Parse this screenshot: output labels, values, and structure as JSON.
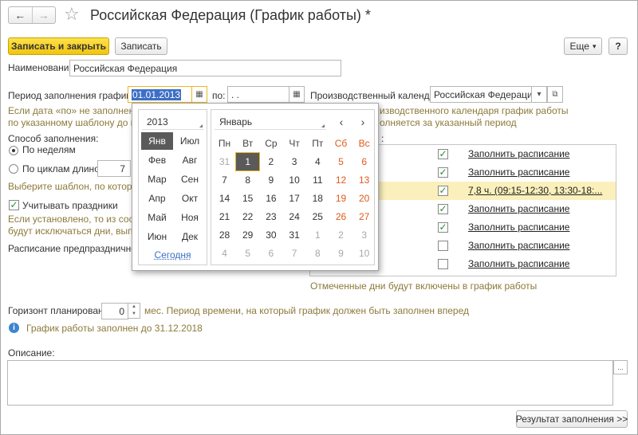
{
  "window": {
    "title": "Российская Федерация (График работы) *",
    "back_glyph": "←",
    "forward_glyph": "→",
    "favorite_glyph": "☆"
  },
  "toolbar": {
    "save_close": "Записать и закрыть",
    "save": "Записать",
    "more": "Еще",
    "more_arrow": "▾",
    "help": "?"
  },
  "form": {
    "name_label": "Наименование:",
    "name_value": "Российская Федерация",
    "period_label": "Период заполнения графика с:",
    "period_from": "01.01.2013",
    "period_to_label": "по:",
    "period_to_value": " .  .",
    "calendar_label": "Производственный календарь:",
    "calendar_value": "Российская Федерация",
    "hint_lines": [
      "Если дата «по» не заполнена, г",
      "по указанному шаблону до конц"
    ],
    "hint_right_lines": [
      "изводственного календаря график работы",
      "олняется за указанный период"
    ],
    "fill_method_label": "Способ заполнения:",
    "by_weeks": "По неделям",
    "by_cycles": "По циклам длиной",
    "cycle_length": "7",
    "template_hint": "Выберите шаблон, по которому",
    "holidays_label": "Учитывать праздники",
    "holidays_checked": true,
    "holidays_hint_lines": [
      "Если установлено, то из состава",
      "будут исключаться дни, выпада"
    ],
    "preholiday_label": "Расписание предпраздничного д",
    "right_colon": ":",
    "horizon_label": "Горизонт планирования:",
    "horizon_value": "0",
    "horizon_hint": "мес. Период времени, на который график должен быть заполнен вперед",
    "info_text": "График работы заполнен до 31.12.2018",
    "description_label": "Описание:",
    "description_value": "",
    "result_button": "Результат заполнения >>",
    "ellipsis": "...",
    "calendar_glyph": "▦",
    "dropdown_glyph": "▾",
    "open_glyph": "⧉",
    "info_glyph": "i",
    "check_glyph": "✓",
    "spin_up": "▲",
    "spin_down": "▼"
  },
  "schedule": {
    "rows": [
      {
        "checked": true,
        "text": "Заполнить расписание",
        "highlight": false
      },
      {
        "checked": true,
        "text": "Заполнить расписание",
        "highlight": false
      },
      {
        "checked": true,
        "text": "7,8 ч. (09:15-12:30, 13:30-18:...",
        "highlight": true
      },
      {
        "checked": true,
        "text": "Заполнить расписание",
        "highlight": false
      },
      {
        "checked": true,
        "text": "Заполнить расписание",
        "highlight": false
      },
      {
        "checked": false,
        "text": "Заполнить расписание",
        "highlight": false
      },
      {
        "checked": false,
        "text": "Заполнить расписание",
        "highlight": false
      }
    ],
    "footer": "Отмеченные дни будут включены в график работы"
  },
  "calendar_popup": {
    "year": "2013",
    "month": "Январь",
    "prev": "‹",
    "next": "›",
    "today": "Сегодня",
    "months": [
      "Янв",
      "Июл",
      "Фев",
      "Авг",
      "Мар",
      "Сен",
      "Апр",
      "Окт",
      "Май",
      "Ноя",
      "Июн",
      "Дек"
    ],
    "current_month": "Янв",
    "weekdays": [
      "Пн",
      "Вт",
      "Ср",
      "Чт",
      "Пт",
      "Сб",
      "Вс"
    ],
    "weeks": [
      [
        "31",
        "1",
        "2",
        "3",
        "4",
        "5",
        "6"
      ],
      [
        "7",
        "8",
        "9",
        "10",
        "11",
        "12",
        "13"
      ],
      [
        "14",
        "15",
        "16",
        "17",
        "18",
        "19",
        "20"
      ],
      [
        "21",
        "22",
        "23",
        "24",
        "25",
        "26",
        "27"
      ],
      [
        "28",
        "29",
        "30",
        "31",
        "1",
        "2",
        "3"
      ],
      [
        "4",
        "5",
        "6",
        "7",
        "8",
        "9",
        "10"
      ]
    ],
    "selected_day": "1",
    "first_row_leading_other": 1,
    "last_row_trailing_other": 3
  }
}
